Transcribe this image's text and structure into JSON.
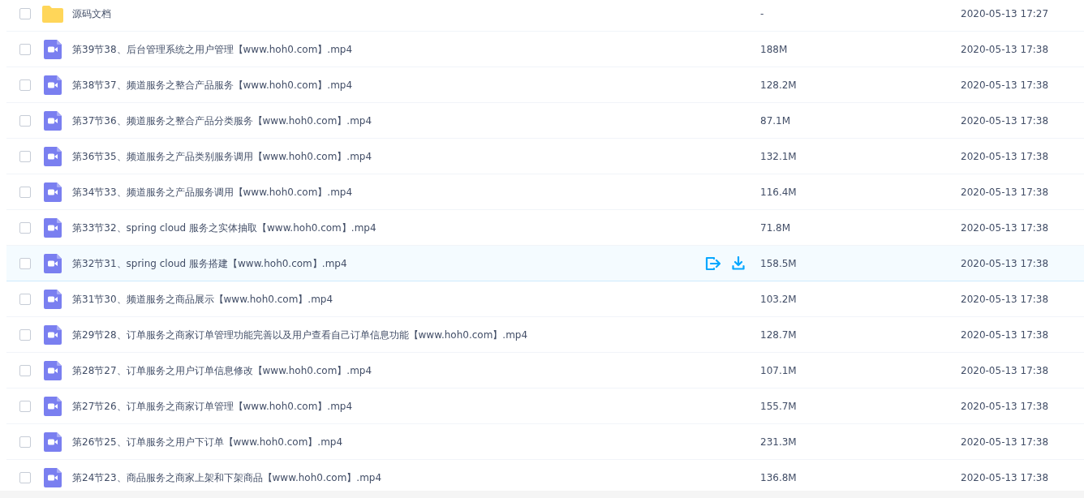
{
  "files": [
    {
      "kind": "folder",
      "name": "源码文档",
      "size": "-",
      "modified": "2020-05-13 17:27",
      "checked": false,
      "hovered": false
    },
    {
      "kind": "video",
      "name": "第39节38、后台管理系统之用户管理【www.hoh0.com】.mp4",
      "size": "188M",
      "modified": "2020-05-13 17:38",
      "checked": false,
      "hovered": false
    },
    {
      "kind": "video",
      "name": "第38节37、频道服务之整合产品服务【www.hoh0.com】.mp4",
      "size": "128.2M",
      "modified": "2020-05-13 17:38",
      "checked": false,
      "hovered": false
    },
    {
      "kind": "video",
      "name": "第37节36、频道服务之整合产品分类服务【www.hoh0.com】.mp4",
      "size": "87.1M",
      "modified": "2020-05-13 17:38",
      "checked": false,
      "hovered": false
    },
    {
      "kind": "video",
      "name": "第36节35、频道服务之产品类别服务调用【www.hoh0.com】.mp4",
      "size": "132.1M",
      "modified": "2020-05-13 17:38",
      "checked": false,
      "hovered": false
    },
    {
      "kind": "video",
      "name": "第34节33、频道服务之产品服务调用【www.hoh0.com】.mp4",
      "size": "116.4M",
      "modified": "2020-05-13 17:38",
      "checked": false,
      "hovered": false
    },
    {
      "kind": "video",
      "name": "第33节32、spring cloud 服务之实体抽取【www.hoh0.com】.mp4",
      "size": "71.8M",
      "modified": "2020-05-13 17:38",
      "checked": false,
      "hovered": false
    },
    {
      "kind": "video",
      "name": "第32节31、spring cloud 服务搭建【www.hoh0.com】.mp4",
      "size": "158.5M",
      "modified": "2020-05-13 17:38",
      "checked": false,
      "hovered": true
    },
    {
      "kind": "video",
      "name": "第31节30、频道服务之商品展示【www.hoh0.com】.mp4",
      "size": "103.2M",
      "modified": "2020-05-13 17:38",
      "checked": false,
      "hovered": false
    },
    {
      "kind": "video",
      "name": "第29节28、订单服务之商家订单管理功能完善以及用户查看自己订单信息功能【www.hoh0.com】.mp4",
      "size": "128.7M",
      "modified": "2020-05-13 17:38",
      "checked": false,
      "hovered": false
    },
    {
      "kind": "video",
      "name": "第28节27、订单服务之用户订单信息修改【www.hoh0.com】.mp4",
      "size": "107.1M",
      "modified": "2020-05-13 17:38",
      "checked": false,
      "hovered": false
    },
    {
      "kind": "video",
      "name": "第27节26、订单服务之商家订单管理【www.hoh0.com】.mp4",
      "size": "155.7M",
      "modified": "2020-05-13 17:38",
      "checked": false,
      "hovered": false
    },
    {
      "kind": "video",
      "name": "第26节25、订单服务之用户下订单【www.hoh0.com】.mp4",
      "size": "231.3M",
      "modified": "2020-05-13 17:38",
      "checked": false,
      "hovered": false
    },
    {
      "kind": "video",
      "name": "第24节23、商品服务之商家上架和下架商品【www.hoh0.com】.mp4",
      "size": "136.8M",
      "modified": "2020-05-13 17:38",
      "checked": false,
      "hovered": false
    }
  ]
}
